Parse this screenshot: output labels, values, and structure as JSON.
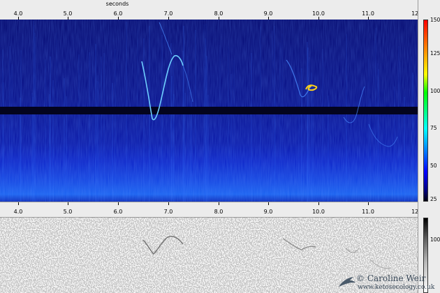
{
  "axis": {
    "units_label": "seconds",
    "ticks": [
      "4.0",
      "5.0",
      "6.0",
      "7.0",
      "8.0",
      "9.0",
      "10.0",
      "11.0",
      "12.0"
    ]
  },
  "colorbar": {
    "labels": [
      "150",
      "125",
      "100",
      "75",
      "50",
      "25"
    ]
  },
  "waveform_scale": {
    "label": "100"
  },
  "watermark": {
    "copyright": "© Caroline Weir",
    "website": "www.ketosecology.co.uk"
  },
  "colors": {
    "spectrogram_background": "#06086e",
    "whistle_trace": "#6fd0ff",
    "highlight_trace": "#ffd21a",
    "waveform_background": "#fbfbfb",
    "panel_gray": "#ececec"
  }
}
